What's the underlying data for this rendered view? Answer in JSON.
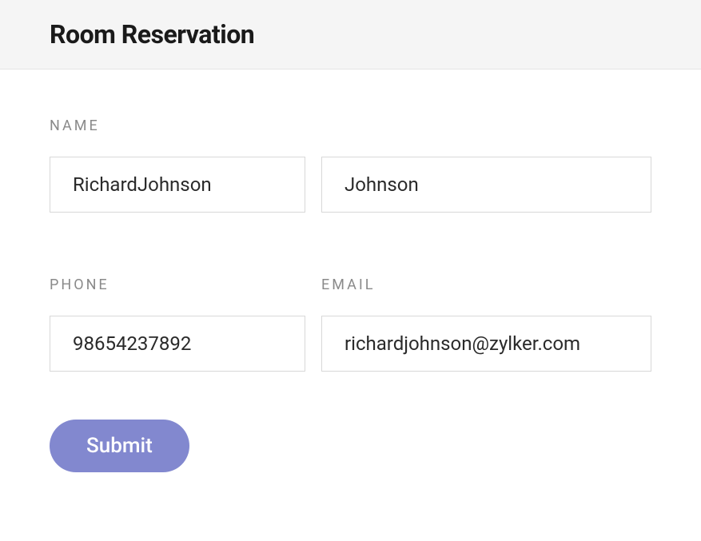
{
  "header": {
    "title": "Room Reservation"
  },
  "form": {
    "name": {
      "label": "NAME",
      "first_value": "RichardJohnson",
      "last_value": "Johnson"
    },
    "phone": {
      "label": "PHONE",
      "value": "98654237892"
    },
    "email": {
      "label": "EMAIL",
      "value": "richardjohnson@zylker.com"
    },
    "submit_label": "Submit"
  }
}
